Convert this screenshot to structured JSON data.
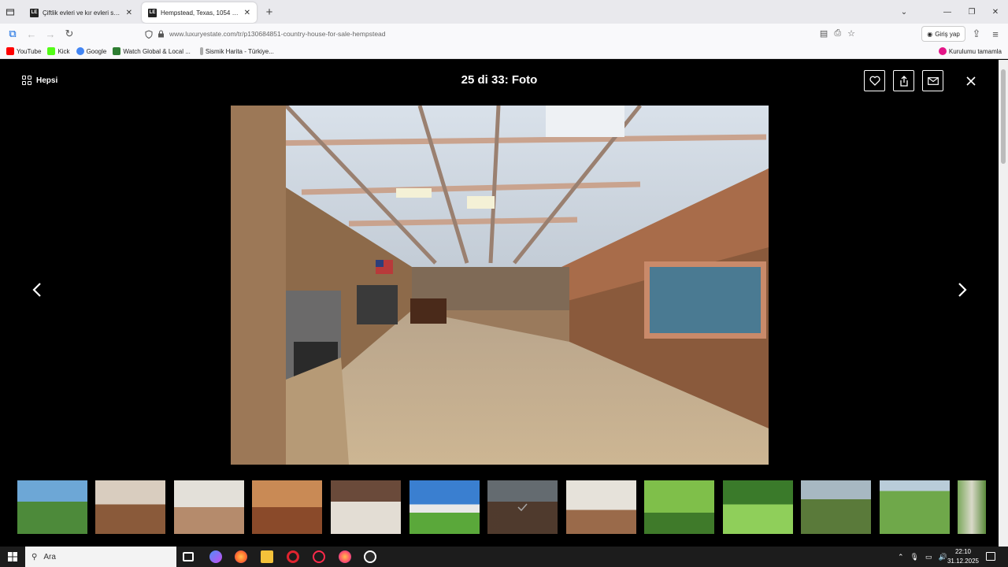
{
  "browser": {
    "tabs": [
      {
        "title": "Çiftlik evleri ve kır evleri satılık A...",
        "favicon": "LE"
      },
      {
        "title": "Hempstead, Texas, 1054 m2 sat...",
        "favicon": "LE"
      }
    ],
    "url": "www.luxuryestate.com/tr/p130684851-country-house-for-sale-hempstead",
    "signin_label": "Giriş yap",
    "bookmarks": [
      {
        "label": "YouTube",
        "color": "#ff0000"
      },
      {
        "label": "Kick",
        "color": "#53fc18"
      },
      {
        "label": "Google",
        "color": "#4285f4"
      },
      {
        "label": "Watch Global & Local ...",
        "color": "#2e7d32"
      },
      {
        "label": "Sismik Harita - Türkiye...",
        "color": "#888888"
      }
    ],
    "bookmark_right": "Kurulumu tamamla"
  },
  "viewer": {
    "all_label": "Hepsi",
    "counter": "25 di 33: Foto",
    "thumbnails_count": 13,
    "selected_thumbnail": 6
  },
  "taskbar": {
    "search_placeholder": "Ara",
    "time": "22:10",
    "date": "31.12.2025"
  }
}
